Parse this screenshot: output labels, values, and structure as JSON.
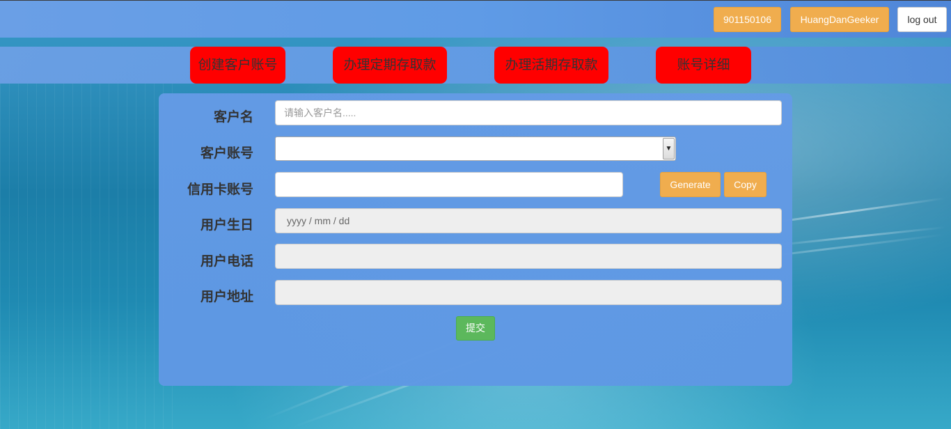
{
  "header": {
    "account_number": "901150106",
    "username": "HuangDanGeeker",
    "logout_label": "log out"
  },
  "nav": {
    "items": [
      {
        "label": "创建客户账号"
      },
      {
        "label": "办理定期存取款"
      },
      {
        "label": "办理活期存取款"
      },
      {
        "label": "账号详细"
      }
    ]
  },
  "form": {
    "customer_name": {
      "label": "客户名",
      "placeholder": "请输入客户名.....",
      "value": ""
    },
    "customer_account": {
      "label": "客户账号",
      "value": ""
    },
    "credit_card": {
      "label": "信用卡账号",
      "value": "",
      "generate_label": "Generate",
      "copy_label": "Copy"
    },
    "birthday": {
      "label": "用户生日",
      "placeholder": "yyyy / mm / dd"
    },
    "phone": {
      "label": "用户电话",
      "value": ""
    },
    "address": {
      "label": "用户地址",
      "value": ""
    },
    "submit_label": "提交"
  },
  "colors": {
    "nav_button": "#ff0000",
    "warning_button": "#f0ad4e",
    "success_button": "#5cb85c",
    "panel": "#619ae5"
  },
  "icons": {
    "select_arrow": "chevron-down-icon"
  }
}
